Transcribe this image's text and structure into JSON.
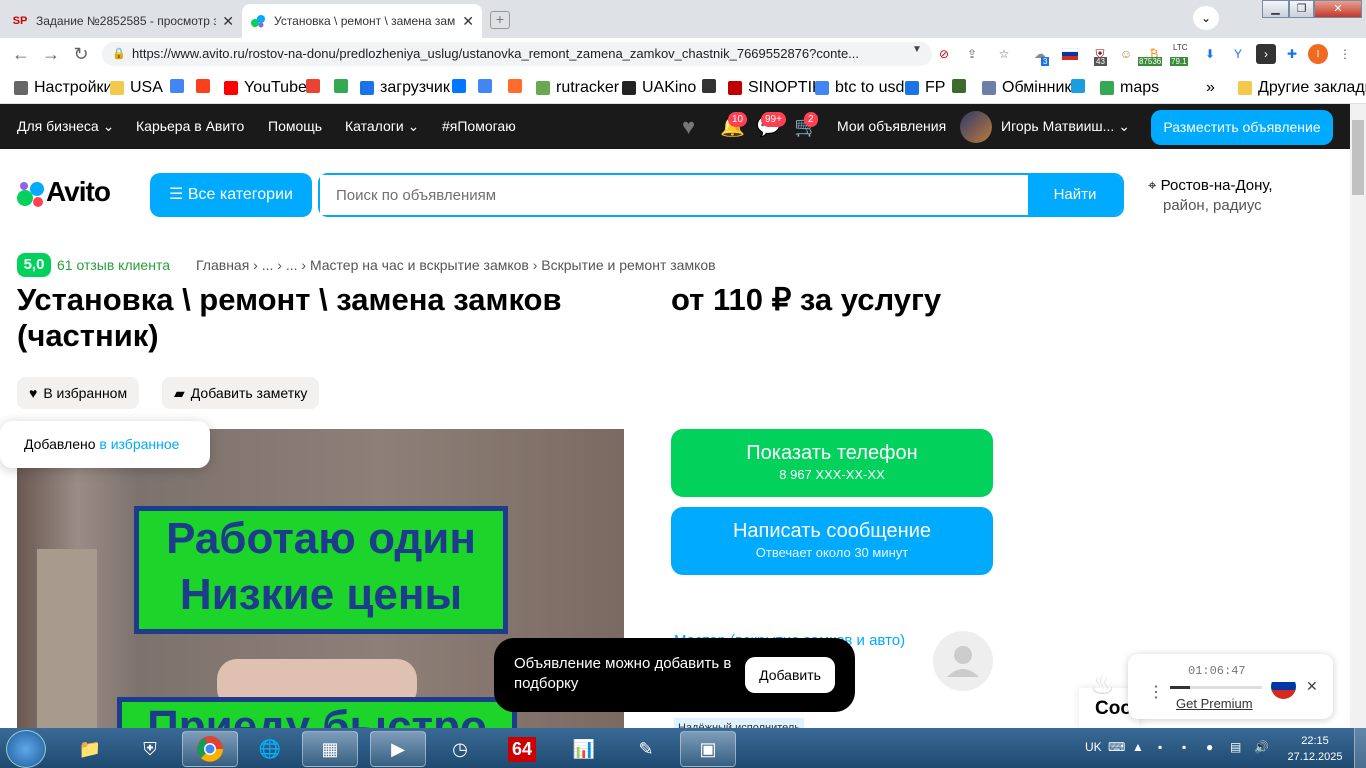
{
  "browser": {
    "tabs": [
      {
        "favicon": "SP",
        "title": "Задание №2852585 - просмотр з",
        "active": false
      },
      {
        "favicon": "avito-icon",
        "title": "Установка \\ ремонт \\ замена зам",
        "active": true
      }
    ],
    "url": "https://www.avito.ru/rostov-na-donu/predlozheniya_uslug/ustanovka_remont_zamena_zamkov_chastnik_7669552876?conte...",
    "ext_badges": {
      "counter1": "3",
      "counter2": "43",
      "btc": "87536",
      "ltc_label": "LTC",
      "ltc": "79.1",
      "profile": "I"
    },
    "bookmarks": [
      {
        "label": "Настройки",
        "icon": "gear-icon",
        "color": "#666666"
      },
      {
        "label": "USA",
        "icon": "folder-icon",
        "color": "#f2c94c"
      },
      {
        "label": "",
        "icon": "google-icon",
        "color": "#4285f4"
      },
      {
        "label": "",
        "icon": "yandex-icon",
        "color": "#fc3f1d"
      },
      {
        "label": "YouTube",
        "icon": "youtube-icon",
        "color": "#ff0000"
      },
      {
        "label": "",
        "icon": "gmail-icon",
        "color": "#ea4335"
      },
      {
        "label": "",
        "icon": "drive-icon",
        "color": "#34a853"
      },
      {
        "label": "загрузчик",
        "icon": "loader-icon",
        "color": "#1a73e8"
      },
      {
        "label": "",
        "icon": "vk-icon",
        "color": "#0077ff"
      },
      {
        "label": "",
        "icon": "translate-icon",
        "color": "#4285f4"
      },
      {
        "label": "",
        "icon": "f-icon",
        "color": "#ff6d2d"
      },
      {
        "label": "rutracker",
        "icon": "rutracker-icon",
        "color": "#6aa84f"
      },
      {
        "label": "UAKino",
        "icon": "uakino-icon",
        "color": "#222222"
      },
      {
        "label": "",
        "icon": "chess-icon",
        "color": "#333333"
      },
      {
        "label": "SINOPTIK",
        "icon": "thermometer-icon",
        "color": "#c00000"
      },
      {
        "label": "btc to usd",
        "icon": "google-icon",
        "color": "#4285f4"
      },
      {
        "label": "FP",
        "icon": "fp-icon",
        "color": "#1a73e8"
      },
      {
        "label": "",
        "icon": "bc-icon",
        "color": "#3d6b2e"
      },
      {
        "label": "Обмінник",
        "icon": "exchange-icon",
        "color": "#6b7fa8"
      },
      {
        "label": "",
        "icon": "snowflake-icon",
        "color": "#1a9ee0"
      },
      {
        "label": "maps",
        "icon": "maps-icon",
        "color": "#34a853"
      },
      {
        "label": "»",
        "icon": "",
        "color": "#333333"
      },
      {
        "label": "Другие закладки",
        "icon": "folder-icon",
        "color": "#f2c94c"
      }
    ]
  },
  "avito": {
    "nav": [
      "Для бизнеса",
      "Карьера в Авито",
      "Помощь",
      "Каталоги",
      "#яПомогаю"
    ],
    "badges": {
      "notifications": "10",
      "messages": "99+",
      "cart": "2"
    },
    "my_ads": "Мои объявления",
    "user_name": "Игорь Матвииш...",
    "post_button": "Разместить объявление",
    "logo_text": "Avito",
    "all_categories": "Все категории",
    "search_placeholder": "Поиск по объявлениям",
    "find_button": "Найти",
    "location_line1": "Ростов-на-Дону,",
    "location_line2": "район, радиус",
    "rating": "5,0",
    "reviews": "61 отзыв клиента",
    "breadcrumbs": "Главная › ... › ... › Мастер на час и вскрытие замков › Вскрытие и ремонт замков",
    "title": "Установка \\ ремонт \\ замена замков (частник)",
    "price": "от 110 ₽ за услугу",
    "favorite_chip": "В избранном",
    "note_chip": "Добавить заметку",
    "fav_tip_prefix": "Добавлено ",
    "fav_tip_link": "в избранное",
    "photo_sign_line1": "Работаю один",
    "photo_sign_line2": "Низкие цены",
    "photo_sign2": "Приеду быстро",
    "call_button": "Показать телефон",
    "call_phone": "8 967 XXX-XX-XX",
    "message_button": "Написать сообщение",
    "message_sub": "Отвечает около 30 минут",
    "seller_partial": "Мастер (вскрытие замков и авто)",
    "reliable_label": "Надёжный исполнитель",
    "toast_text": "Объявление можно добавить в подборку",
    "toast_button": "Добавить",
    "cookie_partial": "Coo"
  },
  "widget": {
    "time": "01:06:47",
    "link": "Get Premium"
  },
  "taskbar": {
    "lang": "UK",
    "time": "22:15",
    "date": "27.12.2025",
    "app_64": "64"
  },
  "colors": {
    "avito_blue": "#00aaff",
    "avito_green": "#02d15c",
    "header_dark": "#1a1a1a"
  }
}
